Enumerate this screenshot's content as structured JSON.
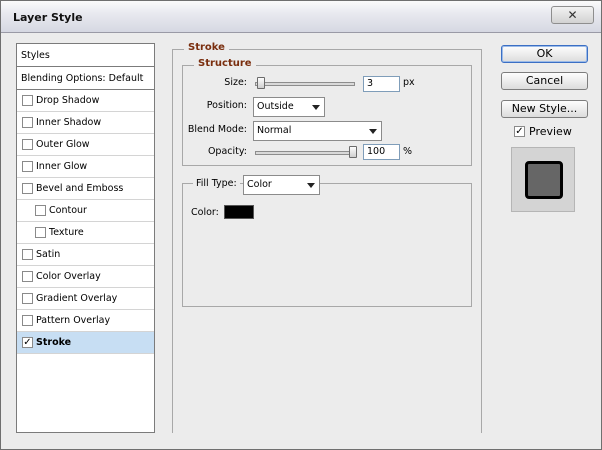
{
  "window": {
    "title": "Layer Style",
    "close_label": "✕"
  },
  "styles_panel": {
    "header": "Styles",
    "blending": "Blending Options: Default",
    "items": [
      {
        "label": "Drop Shadow",
        "checked": false,
        "sub": false
      },
      {
        "label": "Inner Shadow",
        "checked": false,
        "sub": false
      },
      {
        "label": "Outer Glow",
        "checked": false,
        "sub": false
      },
      {
        "label": "Inner Glow",
        "checked": false,
        "sub": false
      },
      {
        "label": "Bevel and Emboss",
        "checked": false,
        "sub": false
      },
      {
        "label": "Contour",
        "checked": false,
        "sub": true
      },
      {
        "label": "Texture",
        "checked": false,
        "sub": true
      },
      {
        "label": "Satin",
        "checked": false,
        "sub": false
      },
      {
        "label": "Color Overlay",
        "checked": false,
        "sub": false
      },
      {
        "label": "Gradient Overlay",
        "checked": false,
        "sub": false
      },
      {
        "label": "Pattern Overlay",
        "checked": false,
        "sub": false
      },
      {
        "label": "Stroke",
        "checked": true,
        "sub": false,
        "selected": true
      }
    ]
  },
  "stroke": {
    "title": "Stroke",
    "structure_title": "Structure",
    "size_label": "Size:",
    "size_value": "3",
    "size_unit": "px",
    "size_slider_fraction": 0.03,
    "position_label": "Position:",
    "position_value": "Outside",
    "blend_label": "Blend Mode:",
    "blend_value": "Normal",
    "opacity_label": "Opacity:",
    "opacity_value": "100",
    "opacity_unit": "%",
    "opacity_slider_fraction": 1.0,
    "fill_type_label": "Fill Type:",
    "fill_type_value": "Color",
    "color_label": "Color:",
    "color_value": "#000000"
  },
  "buttons": {
    "ok": "OK",
    "cancel": "Cancel",
    "new_style": "New Style...",
    "preview_label": "Preview",
    "preview_checked": true
  },
  "colors": {
    "accent": "#c7def3",
    "section_title": "#7a2e0e"
  }
}
